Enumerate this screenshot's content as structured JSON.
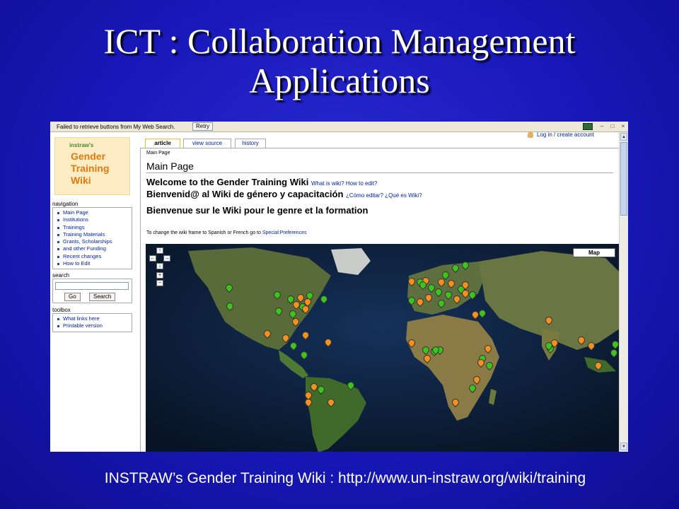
{
  "slide": {
    "title_line1": "ICT : Collaboration Management",
    "title_line2": "Applications",
    "caption": "INSTRAW’s Gender Training Wiki : http://www.un-instraw.org/wiki/training"
  },
  "browser": {
    "toolbar_message": "Failed to retrieve buttons from My Web Search.",
    "retry_label": "Retry",
    "login_label": "Log in / create account"
  },
  "logo": {
    "small": "instraw's",
    "line1": "Gender",
    "line2": "Training",
    "line3": "Wiki"
  },
  "sidebar": {
    "navigation_title": "navigation",
    "navigation_items": [
      "Main Page",
      "Institutions",
      "Trainings",
      "Training Materials",
      "Grants, Scholarships",
      "and other Funding",
      "Recent changes",
      "How to Edit"
    ],
    "search_title": "search",
    "go_label": "Go",
    "search_label": "Search",
    "toolbox_title": "toolbox",
    "toolbox_items": [
      "What links here",
      "Printable version"
    ]
  },
  "tabs": {
    "article": "article",
    "view_source": "view source",
    "history": "history"
  },
  "page": {
    "breadcrumb": "Main Page",
    "heading": "Main Page",
    "welcome_en": "Welcome to the Gender Training Wiki",
    "welcome_en_links": "What is wiki? How to edit?",
    "welcome_es": "Bienvenid@ al Wiki de género y capacitación",
    "welcome_es_links": "¿Cómo editar? ¿Qué es Wiki?",
    "welcome_fr": "Bienvenue sur le Wiki pour le genre et la formation",
    "note_text": "To change the wiki frame to Spanish or French go to ",
    "note_link": "Special:Preferences"
  },
  "map": {
    "type_button": "Map",
    "marker_colors": {
      "green": "#3cc31c",
      "orange": "#f5901e"
    },
    "land_color": "#5a6b3a",
    "ocean_color": "#0b1a30"
  }
}
